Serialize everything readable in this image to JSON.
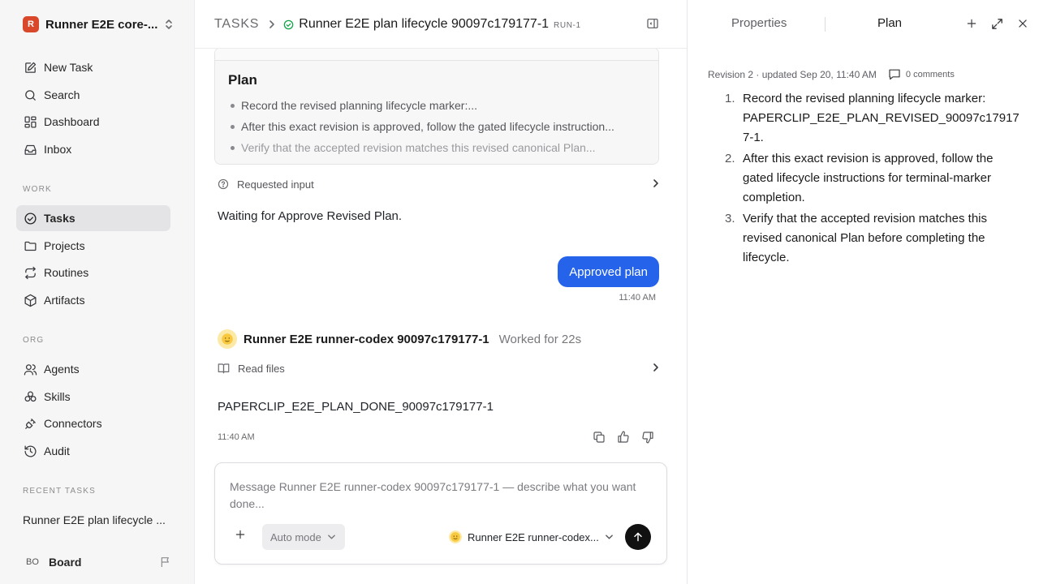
{
  "workspace": {
    "logo_letter": "R",
    "name": "Runner E2E core-..."
  },
  "nav": {
    "top": [
      {
        "label": "New Task",
        "icon": "pencil-square-icon"
      },
      {
        "label": "Search",
        "icon": "search-icon"
      },
      {
        "label": "Dashboard",
        "icon": "grid-icon"
      },
      {
        "label": "Inbox",
        "icon": "inbox-icon"
      }
    ],
    "work_label": "WORK",
    "work": [
      {
        "label": "Tasks",
        "icon": "check-circle-icon",
        "active": true
      },
      {
        "label": "Projects",
        "icon": "folder-icon"
      },
      {
        "label": "Routines",
        "icon": "repeat-icon"
      },
      {
        "label": "Artifacts",
        "icon": "box-icon"
      }
    ],
    "org_label": "ORG",
    "org": [
      {
        "label": "Agents",
        "icon": "users-icon"
      },
      {
        "label": "Skills",
        "icon": "skills-icon"
      },
      {
        "label": "Connectors",
        "icon": "plug-icon"
      },
      {
        "label": "Audit",
        "icon": "history-icon"
      }
    ],
    "recent_label": "RECENT TASKS",
    "recent": [
      "Runner E2E plan lifecycle ..."
    ],
    "user": {
      "initials": "BO",
      "name": "Board"
    }
  },
  "header": {
    "root": "TASKS",
    "title": "Runner E2E plan lifecycle 90097c179177-1",
    "run_id": "RUN-1"
  },
  "plan_card": {
    "title": "Plan",
    "items": [
      "Record the revised planning lifecycle marker:...",
      "After this exact revision is approved, follow the gated lifecycle instruction...",
      "Verify that the accepted revision matches this revised canonical Plan..."
    ]
  },
  "requested_input": {
    "label": "Requested input"
  },
  "waiting_text": "Waiting for Approve Revised Plan.",
  "user_message": {
    "text": "Approved plan",
    "time": "11:40 AM"
  },
  "agent_message": {
    "name": "Runner E2E runner-codex 90097c179177-1",
    "worked": "Worked for 22s",
    "tool_label": "Read files",
    "result": "PAPERCLIP_E2E_PLAN_DONE_90097c179177-1",
    "time": "11:40 AM"
  },
  "composer": {
    "placeholder": "Message Runner E2E runner-codex 90097c179177-1 — describe what you want done...",
    "mode": "Auto mode",
    "agent": "Runner E2E runner-codex..."
  },
  "right_panel": {
    "tab_properties": "Properties",
    "tab_plan": "Plan",
    "meta": "Revision 2 · updated Sep 20, 11:40 AM",
    "comments": "0 comments",
    "plan_items": [
      {
        "num": "1.",
        "text": "Record the revised planning lifecycle marker: PAPERCLIP_E2E_PLAN_REVISED_90097c179177-1."
      },
      {
        "num": "2.",
        "text": "After this exact revision is approved, follow the gated lifecycle instructions for terminal-marker completion."
      },
      {
        "num": "3.",
        "text": "Verify that the accepted revision matches this revised canonical Plan before completing the lifecycle."
      }
    ]
  },
  "colors": {
    "accent": "#2563eb",
    "logo": "#d9482b",
    "active_bg": "#e4e4e6",
    "status_ok": "#16a34a"
  }
}
